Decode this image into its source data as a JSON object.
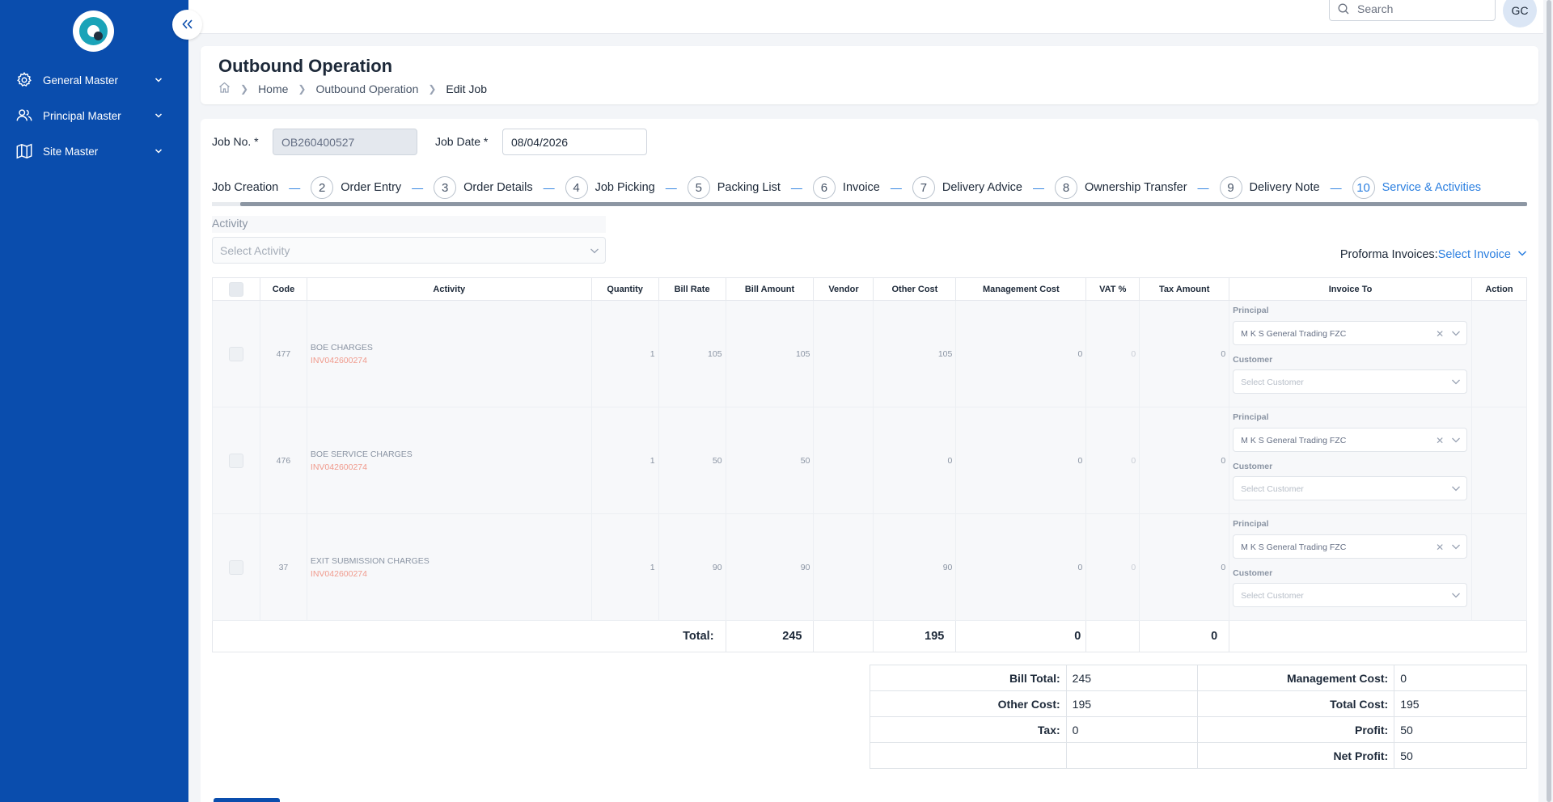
{
  "sidebar": {
    "logo": "app-logo",
    "items": [
      {
        "label": "General Master",
        "icon": "gear-icon"
      },
      {
        "label": "Principal Master",
        "icon": "users-icon"
      },
      {
        "label": "Site Master",
        "icon": "map-icon"
      }
    ]
  },
  "topbar": {
    "search_placeholder": "Search",
    "avatar_initials": "GC"
  },
  "header": {
    "title": "Outbound Operation",
    "breadcrumb": [
      "Home",
      "Outbound Operation",
      "Edit Job"
    ]
  },
  "form": {
    "job_no_label": "Job No. *",
    "job_no_value": "OB260400527",
    "job_date_label": "Job Date *",
    "job_date_value": "08/04/2026"
  },
  "steps": [
    {
      "num": "",
      "label": "Job Creation"
    },
    {
      "num": "2",
      "label": "Order Entry"
    },
    {
      "num": "3",
      "label": "Order Details"
    },
    {
      "num": "4",
      "label": "Job Picking"
    },
    {
      "num": "5",
      "label": "Packing List"
    },
    {
      "num": "6",
      "label": "Invoice"
    },
    {
      "num": "7",
      "label": "Delivery Advice"
    },
    {
      "num": "8",
      "label": "Ownership Transfer"
    },
    {
      "num": "9",
      "label": "Delivery Note"
    },
    {
      "num": "10",
      "label": "Service & Activities"
    }
  ],
  "activity": {
    "label": "Activity",
    "placeholder": "Select Activity"
  },
  "proforma": {
    "label": "Proforma Invoices:",
    "link": "Select Invoice"
  },
  "table": {
    "headers": [
      "",
      "Code",
      "Activity",
      "Quantity",
      "Bill Rate",
      "Bill Amount",
      "Vendor",
      "Other Cost",
      "Management Cost",
      "VAT %",
      "Tax Amount",
      "Invoice To",
      "Action"
    ],
    "principal_label": "Principal",
    "customer_label": "Customer",
    "customer_placeholder": "Select Customer",
    "rows": [
      {
        "code": "477",
        "activity": "BOE CHARGES",
        "invoice": "INV042600274",
        "quantity": "1",
        "bill_rate": "105",
        "bill_amount": "105",
        "vendor": "",
        "other_cost": "105",
        "management_cost": "0",
        "vat": "0",
        "tax_amount": "0",
        "principal": "M K S General Trading FZC"
      },
      {
        "code": "476",
        "activity": "BOE SERVICE CHARGES",
        "invoice": "INV042600274",
        "quantity": "1",
        "bill_rate": "50",
        "bill_amount": "50",
        "vendor": "",
        "other_cost": "0",
        "management_cost": "0",
        "vat": "0",
        "tax_amount": "0",
        "principal": "M K S General Trading FZC"
      },
      {
        "code": "37",
        "activity": "EXIT SUBMISSION CHARGES",
        "invoice": "INV042600274",
        "quantity": "1",
        "bill_rate": "90",
        "bill_amount": "90",
        "vendor": "",
        "other_cost": "90",
        "management_cost": "0",
        "vat": "0",
        "tax_amount": "0",
        "principal": "M K S General Trading FZC"
      }
    ],
    "total": {
      "label": "Total:",
      "bill_amount": "245",
      "other_cost": "195",
      "management_cost": "0",
      "tax_amount": "0"
    }
  },
  "summary": {
    "bill_total_label": "Bill Total:",
    "bill_total": "245",
    "management_cost_label": "Management Cost:",
    "management_cost": "0",
    "other_cost_label": "Other Cost:",
    "other_cost": "195",
    "total_cost_label": "Total Cost:",
    "total_cost": "195",
    "tax_label": "Tax:",
    "tax": "0",
    "profit_label": "Profit:",
    "profit": "50",
    "net_profit_label": "Net Profit:",
    "net_profit": "50"
  }
}
